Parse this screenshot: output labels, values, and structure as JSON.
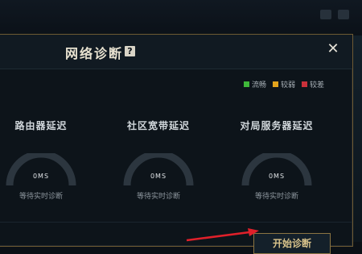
{
  "dialog": {
    "title": "网络诊断",
    "help_glyph": "?",
    "close_glyph": "✕"
  },
  "legend": [
    {
      "label": "流畅",
      "color": "#3fb83a"
    },
    {
      "label": "较弱",
      "color": "#e2a31c"
    },
    {
      "label": "较差",
      "color": "#c9303a"
    }
  ],
  "metrics": [
    {
      "label": "路由器延迟",
      "value": "0MS",
      "status": "等待实时诊断"
    },
    {
      "label": "社区宽带延迟",
      "value": "0MS",
      "status": "等待实时诊断"
    },
    {
      "label": "对局服务器延迟",
      "value": "0MS",
      "status": "等待实时诊断"
    }
  ],
  "start_button": {
    "label": "开始诊断"
  },
  "colors": {
    "accent_gold": "#8a7442",
    "arrow_red": "#e0202a"
  }
}
